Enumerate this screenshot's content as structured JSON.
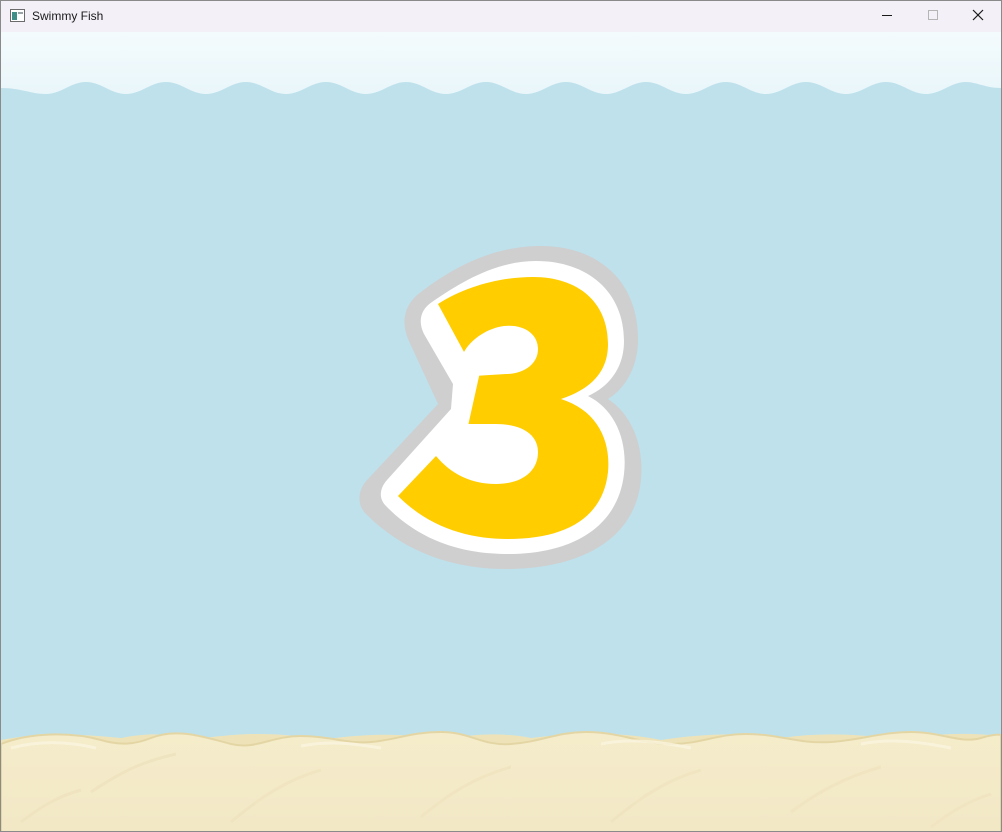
{
  "window": {
    "title": "Swimmy Fish",
    "app_icon": "window-app-icon",
    "controls": {
      "minimize_icon": "minimize-icon",
      "maximize_icon": "maximize-icon",
      "close_icon": "close-icon"
    }
  },
  "game": {
    "countdown_value": "3",
    "colors": {
      "sky": "#f1f9fc",
      "water": "#bee1ec",
      "sand": "#f4ecc9",
      "sand_edge": "#e6d9a8",
      "digit_fill": "#ffcd00",
      "digit_outline": "#ffffff",
      "digit_shadow": "#cfcfcf"
    }
  }
}
